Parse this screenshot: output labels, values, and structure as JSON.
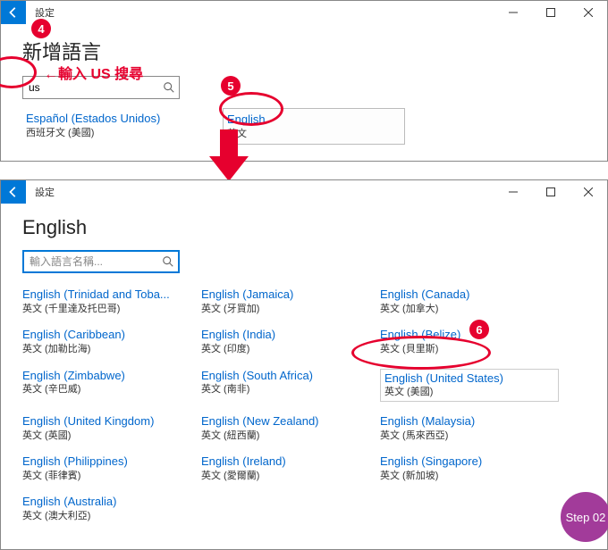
{
  "annotations": {
    "badge4": "4",
    "badge5": "5",
    "badge6": "6",
    "instruction_text": "←輸入 US 搜尋",
    "step_label": "Step 02"
  },
  "window1": {
    "title": "設定",
    "heading": "新增語言",
    "search_value": "us",
    "results": [
      {
        "lang": "Español (Estados Unidos)",
        "sub": "西班牙文 (美國)"
      },
      {
        "lang": "English",
        "sub": "英文"
      }
    ]
  },
  "window2": {
    "title": "設定",
    "heading": "English",
    "search_placeholder": "輸入語言名稱...",
    "items": [
      {
        "lang": "English (Trinidad and Toba...",
        "sub": "英文 (千里達及托巴哥)"
      },
      {
        "lang": "English (Jamaica)",
        "sub": "英文 (牙買加)"
      },
      {
        "lang": "English (Canada)",
        "sub": "英文 (加拿大)"
      },
      {
        "lang": "English (Caribbean)",
        "sub": "英文 (加勒比海)"
      },
      {
        "lang": "English (India)",
        "sub": "英文 (印度)"
      },
      {
        "lang": "English (Belize)",
        "sub": "英文 (貝里斯)"
      },
      {
        "lang": "English (Zimbabwe)",
        "sub": "英文 (辛巴威)"
      },
      {
        "lang": "English (South Africa)",
        "sub": "英文 (南非)"
      },
      {
        "lang": "English (United States)",
        "sub": "英文 (美國)",
        "boxed": true
      },
      {
        "lang": "English (United Kingdom)",
        "sub": "英文 (英國)"
      },
      {
        "lang": "English (New Zealand)",
        "sub": "英文 (紐西蘭)"
      },
      {
        "lang": "English (Malaysia)",
        "sub": "英文 (馬來西亞)"
      },
      {
        "lang": "English (Philippines)",
        "sub": "英文 (菲律賓)"
      },
      {
        "lang": "English (Ireland)",
        "sub": "英文 (愛爾蘭)"
      },
      {
        "lang": "English (Singapore)",
        "sub": "英文 (新加坡)"
      },
      {
        "lang": "English (Australia)",
        "sub": "英文 (澳大利亞)"
      }
    ]
  }
}
